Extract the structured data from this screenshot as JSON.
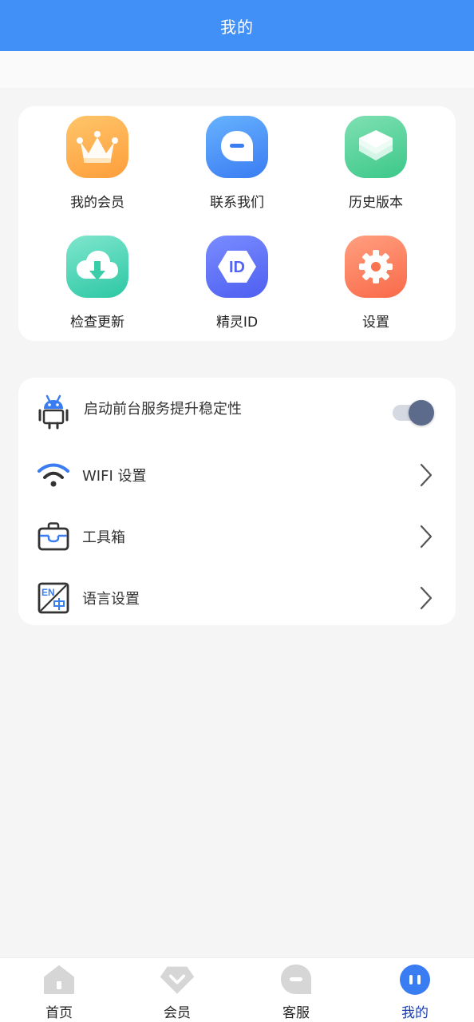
{
  "header": {
    "title": "我的"
  },
  "grid": {
    "items": [
      {
        "label": "我的会员",
        "icon": "crown-icon"
      },
      {
        "label": "联系我们",
        "icon": "chat-bubble-icon"
      },
      {
        "label": "历史版本",
        "icon": "layers-icon"
      },
      {
        "label": "检查更新",
        "icon": "cloud-download-icon"
      },
      {
        "label": "精灵ID",
        "icon": "id-badge-icon",
        "icon_text": "ID"
      },
      {
        "label": "设置",
        "icon": "gear-icon"
      }
    ]
  },
  "settings_list": {
    "items": [
      {
        "label": "启动前台服务提升稳定性",
        "icon": "android-robot-icon",
        "control": "toggle",
        "toggle_on": true
      },
      {
        "label": "WIFI 设置",
        "icon": "wifi-icon",
        "control": "chevron"
      },
      {
        "label": "工具箱",
        "icon": "toolbox-icon",
        "control": "chevron"
      },
      {
        "label": "语言设置",
        "icon": "language-icon",
        "control": "chevron"
      }
    ]
  },
  "bottom_nav": {
    "items": [
      {
        "label": "首页",
        "icon": "home-icon",
        "active": false
      },
      {
        "label": "会员",
        "icon": "diamond-icon",
        "active": false
      },
      {
        "label": "客服",
        "icon": "chat-bubble-icon",
        "active": false
      },
      {
        "label": "我的",
        "icon": "profile-icon",
        "active": true
      }
    ]
  },
  "colors": {
    "header_bg": "#4190f7",
    "nav_active": "#1c3fae",
    "nav_inactive_icon": "#d6d6d6"
  }
}
